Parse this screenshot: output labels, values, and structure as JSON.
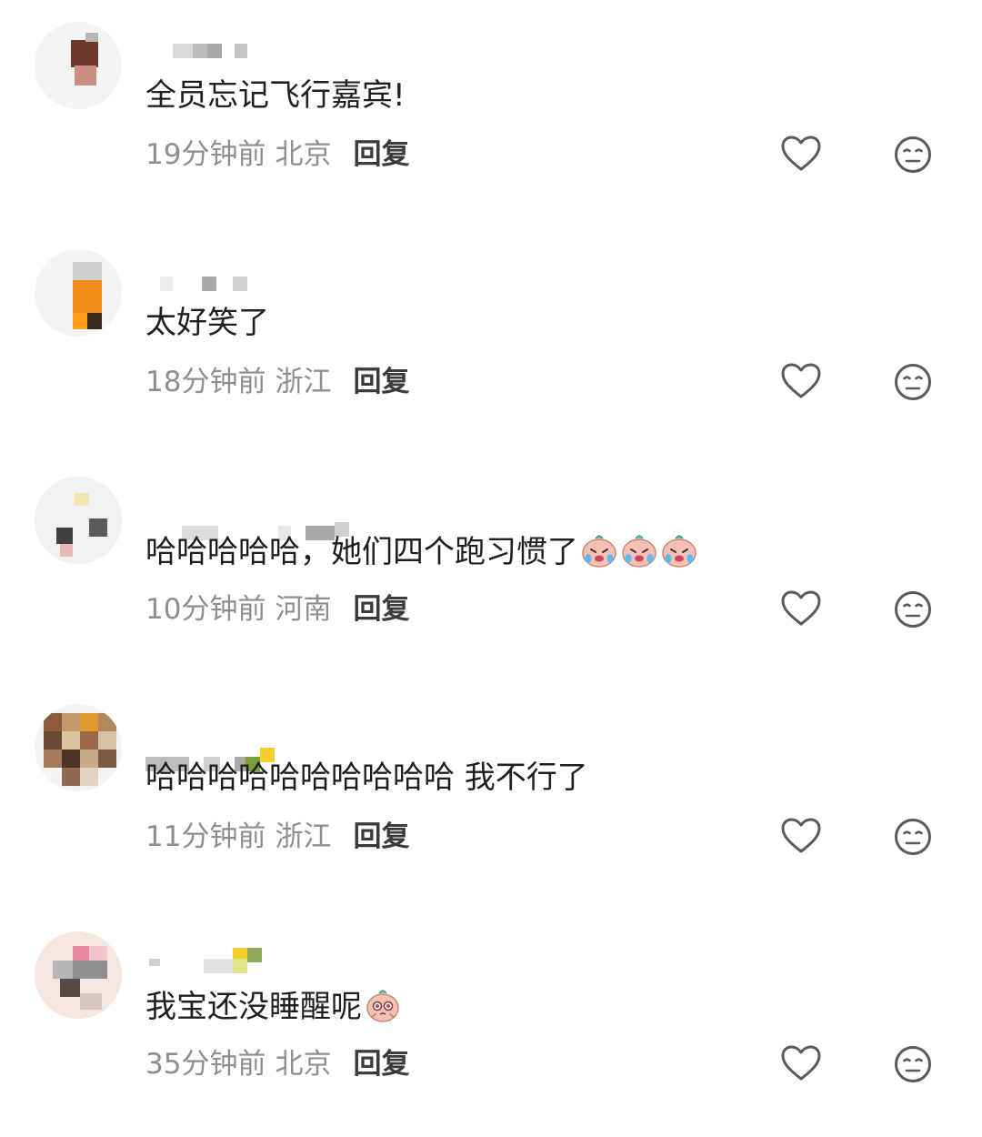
{
  "icons": {
    "like": "heart-outline-icon",
    "dislike": "neutral-face-icon"
  },
  "colors": {
    "meta_gray": "#8e8e8e",
    "reply": "#3b3b3b",
    "icon": "#5a5a5a",
    "text": "#1f1f1f"
  },
  "comments": [
    {
      "text": "全员忘记飞行嘉宾!",
      "time": "19分钟前",
      "location": "北京",
      "reply_label": "回复"
    },
    {
      "text": "太好笑了",
      "time": "18分钟前",
      "location": "浙江",
      "reply_label": "回复"
    },
    {
      "text": "哈哈哈哈哈，她们四个跑习惯了",
      "emoji": "crying-laughing-emoji",
      "time": "10分钟前",
      "location": "河南",
      "reply_label": "回复"
    },
    {
      "text": "哈哈哈哈哈哈哈哈哈哈 我不行了",
      "time": "11分钟前",
      "location": "浙江",
      "reply_label": "回复"
    },
    {
      "text": "我宝还没睡醒呢",
      "emoji": "pleading-face-emoji",
      "time": "35分钟前",
      "location": "北京",
      "reply_label": "回复"
    }
  ]
}
